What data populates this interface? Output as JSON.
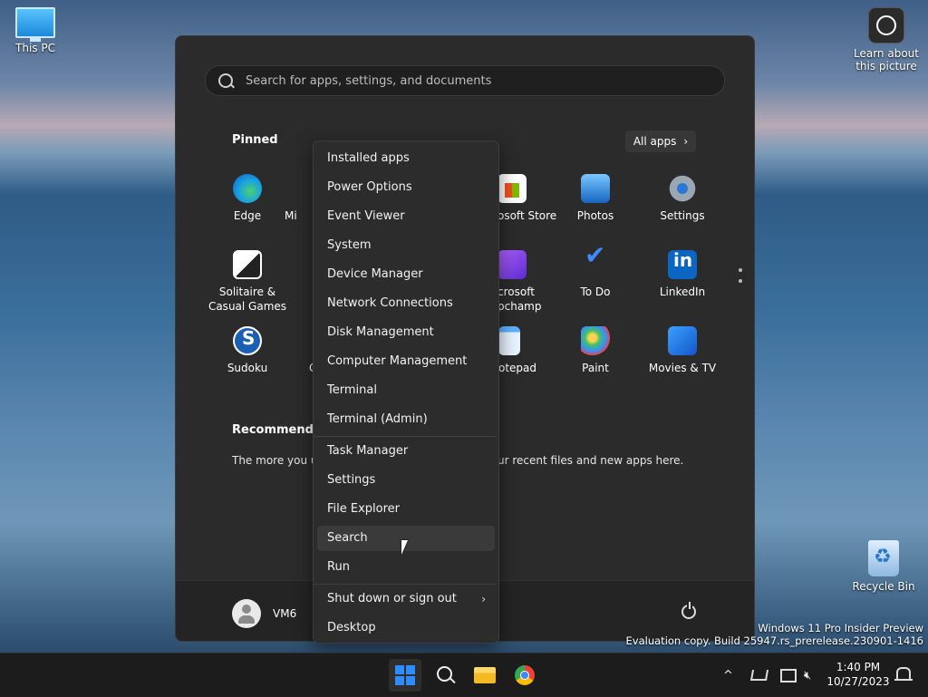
{
  "desktop": {
    "this_pc": "This PC",
    "learn_line1": "Learn about",
    "learn_line2": "this picture",
    "recycle_bin": "Recycle Bin"
  },
  "start": {
    "search_placeholder": "Search for apps, settings, and documents",
    "pinned_title": "Pinned",
    "all_apps_label": "All apps",
    "apps": [
      {
        "name": "Edge",
        "icon": "edge-icon"
      },
      {
        "name": "Mi",
        "icon": "mail-icon"
      },
      {
        "name": "osoft Store",
        "icon": "store-icon"
      },
      {
        "name": "Photos",
        "icon": "photos-icon"
      },
      {
        "name": "Settings",
        "icon": "gear-icon"
      },
      {
        "name": "Solitaire &",
        "name2": "Casual Games",
        "icon": "cards-icon"
      },
      {
        "name": "crosoft",
        "name2": "pchamp",
        "icon": "clipchamp-icon"
      },
      {
        "name": "To Do",
        "icon": "checkmark-icon"
      },
      {
        "name": "LinkedIn",
        "icon": "linkedin-icon"
      },
      {
        "name": "Sudoku",
        "icon": "sudoku-icon"
      },
      {
        "name": "C",
        "icon": "calculator-icon"
      },
      {
        "name": "otepad",
        "icon": "notepad-icon"
      },
      {
        "name": "Paint",
        "icon": "palette-icon"
      },
      {
        "name": "Movies & TV",
        "icon": "movie-icon"
      }
    ],
    "recommended_title": "Recommendec",
    "recommended_text_left": "The more you us",
    "recommended_text_right": "ur recent files and new apps here.",
    "user_name": "VM6"
  },
  "context_menu": {
    "items": [
      "Installed apps",
      "Power Options",
      "Event Viewer",
      "System",
      "Device Manager",
      "Network Connections",
      "Disk Management",
      "Computer Management",
      "Terminal",
      "Terminal (Admin)",
      "Task Manager",
      "Settings",
      "File Explorer",
      "Search",
      "Run",
      "Shut down or sign out",
      "Desktop"
    ],
    "hovered": "Search"
  },
  "watermark": {
    "line1": "Windows 11 Pro Insider Preview",
    "line2": "Evaluation copy. Build 25947.rs_prerelease.230901-1416"
  },
  "taskbar": {
    "time": "1:40 PM",
    "date": "10/27/2023",
    "tray_overflow": "^"
  }
}
